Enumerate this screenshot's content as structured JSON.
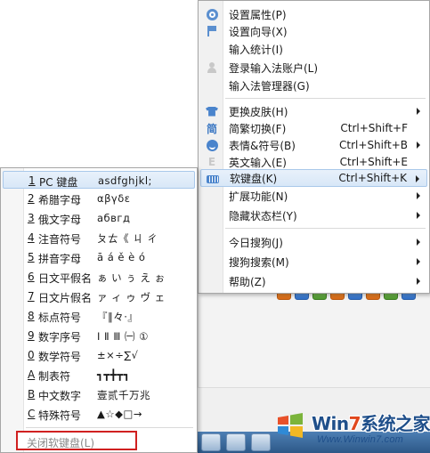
{
  "main_menu": {
    "items": [
      {
        "label": "设置属性(P)",
        "icon": "gear-icon"
      },
      {
        "label": "设置向导(X)",
        "icon": "flag-icon"
      },
      {
        "label": "输入统计(I)",
        "icon": ""
      },
      {
        "label": "登录输入法账户(L)",
        "icon": "user-icon"
      },
      {
        "label": "输入法管理器(G)",
        "icon": ""
      },
      {
        "label": "更换皮肤(H)",
        "icon": "shirt-icon",
        "submenu": true
      },
      {
        "label": "简繁切换(F)",
        "icon": "simplified-icon",
        "shortcut": "Ctrl+Shift+F"
      },
      {
        "label": "表情&符号(B)",
        "icon": "smiley-icon",
        "shortcut": "Ctrl+Shift+B",
        "submenu": true
      },
      {
        "label": "英文输入(E)",
        "icon": "english-icon",
        "shortcut": "Ctrl+Shift+E"
      },
      {
        "label": "软键盘(K)",
        "icon": "keyboard-icon",
        "shortcut": "Ctrl+Shift+K",
        "submenu": true,
        "highlighted": true
      },
      {
        "label": "扩展功能(N)",
        "icon": "",
        "submenu": true
      },
      {
        "label": "隐藏状态栏(Y)",
        "icon": "",
        "submenu": true
      },
      {
        "label": "今日搜狗(J)",
        "icon": "",
        "submenu": true
      },
      {
        "label": "搜狗搜索(M)",
        "icon": "",
        "submenu": true
      },
      {
        "label": "帮助(Z)",
        "icon": "",
        "submenu": true
      }
    ],
    "simplified_glyph": "简",
    "english_glyph": "E"
  },
  "soft_keyboard_menu": {
    "items": [
      {
        "key": "1",
        "label": " PC 键盘",
        "sample": "asdfghjkl;",
        "highlighted": true
      },
      {
        "key": "2",
        "label": " 希腊字母",
        "sample": "αβγδε"
      },
      {
        "key": "3",
        "label": " 俄文字母",
        "sample": "абвгд"
      },
      {
        "key": "4",
        "label": " 注音符号",
        "sample": "ㄆㄊ《 ㄐ ㄔ"
      },
      {
        "key": "5",
        "label": " 拼音字母",
        "sample": "ā á ě è ó"
      },
      {
        "key": "6",
        "label": " 日文平假名",
        "sample": "ぁ い ぅ え ぉ"
      },
      {
        "key": "7",
        "label": " 日文片假名",
        "sample": "ァ ィ ゥ ヴ ェ"
      },
      {
        "key": "8",
        "label": " 标点符号",
        "sample": "『‖々·』"
      },
      {
        "key": "9",
        "label": " 数字序号",
        "sample": "Ⅰ Ⅱ Ⅲ ㈠ ①"
      },
      {
        "key": "0",
        "label": " 数学符号",
        "sample": "±×÷∑√"
      },
      {
        "key": "A",
        "label": " 制表符",
        "sample": "┓┳╋┳┓"
      },
      {
        "key": "B",
        "label": " 中文数字",
        "sample": "壹贰千万兆"
      },
      {
        "key": "C",
        "label": " 特殊符号",
        "sample": "▲☆◆□→"
      }
    ],
    "close_label": "关闭软键盘(L)"
  },
  "watermark": {
    "brand_prefix": "Win",
    "brand_digit": "7",
    "brand_suffix": "系统之家",
    "url": "Www.Winwin7.com"
  },
  "colors": {
    "highlight": "#d8e7f7",
    "accent": "#3c78c3",
    "close_border": "#d02020"
  }
}
